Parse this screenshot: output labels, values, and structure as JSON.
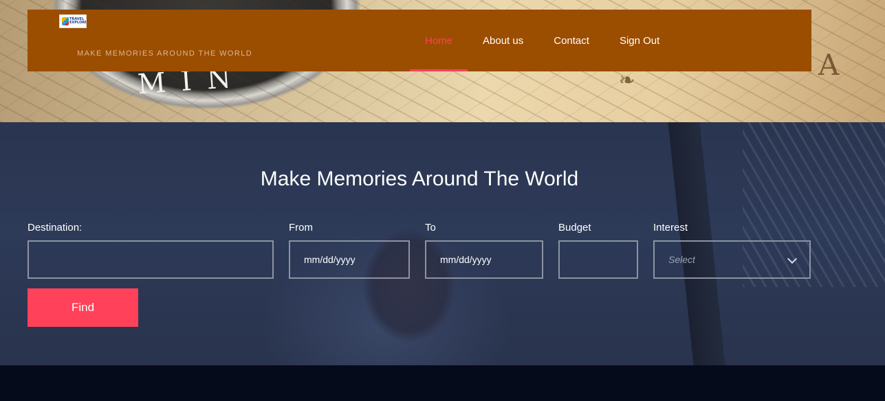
{
  "header": {
    "logo_text": "TRAVEL EXPLORER",
    "tagline": "MAKE MEMORIES AROUND THE WORLD",
    "nav": [
      {
        "label": "Home",
        "active": true
      },
      {
        "label": "About us",
        "active": false
      },
      {
        "label": "Contact",
        "active": false
      },
      {
        "label": "Sign Out",
        "active": false
      }
    ]
  },
  "hero": {
    "compass_letters": "MIN"
  },
  "search": {
    "headline": "Make Memories Around The World",
    "destination": {
      "label": "Destination:",
      "value": ""
    },
    "from": {
      "label": "From",
      "placeholder": "mm/dd/yyyy"
    },
    "to": {
      "label": "To",
      "placeholder": "mm/dd/yyyy"
    },
    "budget": {
      "label": "Budget",
      "value": ""
    },
    "interest": {
      "label": "Interest",
      "placeholder": "Select"
    },
    "find_label": "Find"
  },
  "colors": {
    "header_bg": "#9b4d00",
    "accent": "#ff4259",
    "search_bg": "#2b3652",
    "footer_bg": "#060b1b"
  },
  "icons": {
    "interest_dropdown": "chevron-down-icon"
  }
}
